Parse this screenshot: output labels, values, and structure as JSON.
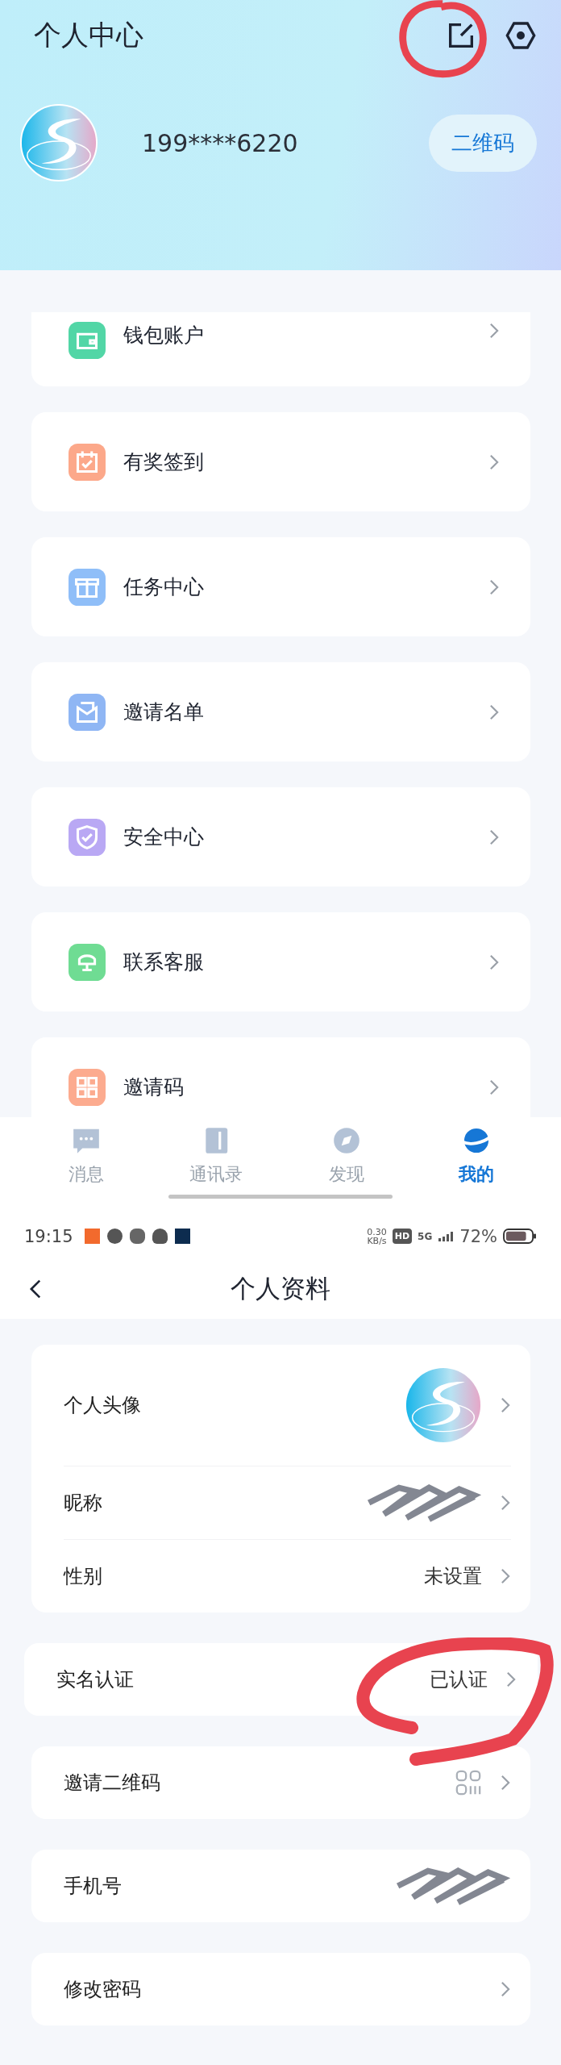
{
  "top": {
    "title": "个人中心",
    "user": "199****6220",
    "qr_button": "二维码"
  },
  "menu": [
    {
      "label": "钱包账户",
      "color": "#52d6a6"
    },
    {
      "label": "有奖签到",
      "color": "#fca88a"
    },
    {
      "label": "任务中心",
      "color": "#8fbef8"
    },
    {
      "label": "邀请名单",
      "color": "#8fb6f4"
    },
    {
      "label": "安全中心",
      "color": "#b9a8f4"
    },
    {
      "label": "联系客服",
      "color": "#6fdc93"
    },
    {
      "label": "邀请码",
      "color": "#fcab8f"
    }
  ],
  "tabs": [
    {
      "label": "消息",
      "selected": false
    },
    {
      "label": "通讯录",
      "selected": false
    },
    {
      "label": "发现",
      "selected": false
    },
    {
      "label": "我的",
      "selected": true
    }
  ],
  "status_bar": {
    "time": "19:15",
    "speed": "0.30",
    "speed_unit": "KB/s",
    "hd": "HD",
    "network": "5G",
    "battery": "72%"
  },
  "profile": {
    "title": "个人资料",
    "groups": [
      {
        "rows": [
          {
            "label": "个人头像",
            "kind": "avatar"
          },
          {
            "label": "昵称",
            "kind": "redacted"
          },
          {
            "label": "性别",
            "kind": "text",
            "value": "未设置"
          }
        ]
      },
      {
        "wide": true,
        "rows": [
          {
            "label": "实名认证",
            "kind": "text",
            "value": "已认证"
          }
        ]
      },
      {
        "rows": [
          {
            "label": "邀请二维码",
            "kind": "qr"
          }
        ]
      },
      {
        "rows": [
          {
            "label": "手机号",
            "kind": "redacted"
          }
        ]
      },
      {
        "rows": [
          {
            "label": "修改密码",
            "kind": "plain"
          }
        ]
      }
    ]
  }
}
